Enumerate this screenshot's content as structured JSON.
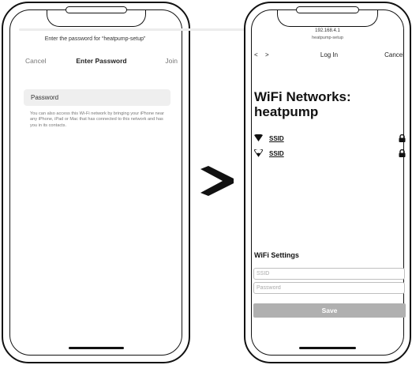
{
  "left_screen": {
    "prompt": "Enter the password for “heatpump-setup”",
    "cancel_label": "Cancel",
    "title": "Enter Password",
    "join_label": "Join",
    "password_placeholder": "Password",
    "help_text": "You can also access this Wi-Fi network by bringing your iPhone near any iPhone, iPad or Mac that has connected to this network and has you in its contacts."
  },
  "right_screen": {
    "address_ip": "192.168.4.1",
    "address_host": "heatpump-setup",
    "back_glyph": "<",
    "forward_glyph": ">",
    "title": "Log In",
    "cancel_label": "Cancel",
    "heading_line1": "WiFi Networks:",
    "heading_line2": "heatpump",
    "networks": [
      {
        "ssid": "SSID",
        "signal": "strong",
        "icon": "wifi-strong-icon",
        "lock_icon": "lock-icon"
      },
      {
        "ssid": "SSID",
        "signal": "weak",
        "icon": "wifi-weak-icon",
        "lock_icon": "lock-icon"
      }
    ],
    "settings_label": "WiFi Settings",
    "ssid_placeholder": "SSID",
    "password_placeholder": "Password",
    "save_label": "Save"
  },
  "arrow_icon": "chevron-right-icon",
  "colors": {
    "outline": "#111111",
    "field_background": "#efefef",
    "save_button": "#b0b0b0"
  }
}
